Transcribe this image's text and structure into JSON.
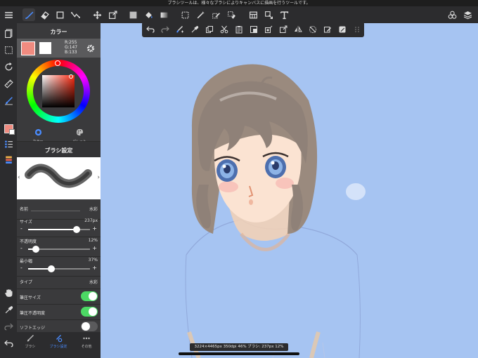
{
  "status_message": "ブラシツールは、様々なブラシによりキャンバスに描画を行うツールです。",
  "toolbar": {
    "icons": [
      "menu-icon",
      "brush-icon",
      "eraser-icon",
      "rectangle-icon",
      "transform-icon",
      "move-icon",
      "selection-icon",
      "fill-color-icon",
      "bucket-icon",
      "gradient-icon",
      "marquee-icon",
      "magic-wand-icon",
      "select-pen-icon",
      "select-eraser-icon",
      "filter-icon",
      "text-icon",
      "material-icon",
      "layers-icon"
    ]
  },
  "color_panel": {
    "title": "カラー",
    "r": "R:255",
    "g": "G:147",
    "b": "B:133",
    "current_color": "#f08b80",
    "tab_color": "カラー",
    "tab_palette": "パレット"
  },
  "brush_panel": {
    "title": "ブラシ設定",
    "name_label": "名前",
    "name_value": "水彩",
    "size_label": "サイズ",
    "size_value": "237px",
    "size_level": 0.78,
    "opacity_label": "不透明度",
    "opacity_value": "12%",
    "opacity_level": 0.12,
    "min_width_label": "最小幅",
    "min_width_value": "37%",
    "min_width_level": 0.37,
    "minus": "-",
    "plus": "+",
    "type_label": "タイプ",
    "type_value": "水彩",
    "pressure_size_label": "筆圧サイズ",
    "pressure_size_on": true,
    "pressure_opacity_label": "筆圧不透明度",
    "pressure_opacity_on": true,
    "soft_edge_label": "ソフトエッジ",
    "soft_edge_on": false
  },
  "bottom_tabs": [
    {
      "label": "ブラシ",
      "icon": "brush-icon"
    },
    {
      "label": "ブラシ設定",
      "icon": "brush-settings-icon"
    },
    {
      "label": "その他",
      "icon": "more-icon"
    }
  ],
  "canvas_status": "3224×4465px 350dpi 46% ブラシ: 237px 12%",
  "colors": {
    "canvas_bg": "#a6c4f2",
    "accent": "#4a8cff",
    "toggle_on": "#4cd964",
    "ui_dark": "#2c2c2e"
  }
}
